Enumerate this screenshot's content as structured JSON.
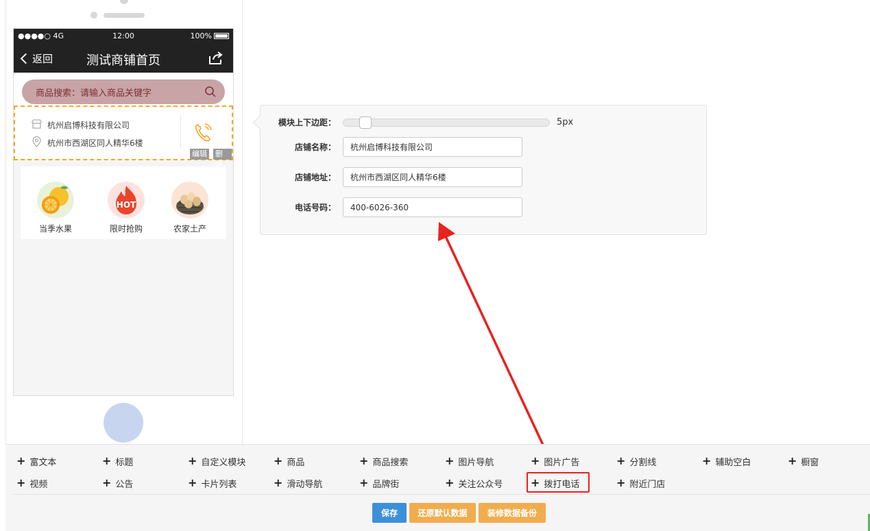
{
  "phone": {
    "status": {
      "signal": "●●●●○ 4G",
      "time": "12:00",
      "battery": "100%"
    },
    "nav": {
      "back_label": "返回",
      "title": "测试商铺首页"
    },
    "search": {
      "placeholder": "商品搜索：请输入商品关键字"
    },
    "shop": {
      "name": "杭州启博科技有限公司",
      "address": "杭州市西湖区同人精华6楼",
      "edit_label": "编辑",
      "delete_label": "删除"
    },
    "categories": [
      {
        "label": "当季水果",
        "icon": "orange-fruit-icon"
      },
      {
        "label": "限时抢购",
        "icon": "hot-sale-icon"
      },
      {
        "label": "农家土产",
        "icon": "eggs-basket-icon"
      }
    ]
  },
  "panel": {
    "margin_label": "模块上下边距：",
    "margin_value": "5px",
    "margin_fraction": 0.08,
    "shop_name_label": "店铺名称：",
    "shop_name_value": "杭州启博科技有限公司",
    "shop_address_label": "店铺地址：",
    "shop_address_value": "杭州市西湖区同人精华6楼",
    "phone_label": "电话号码：",
    "phone_value": "400-6026-360"
  },
  "toolbar": {
    "row1": [
      "富文本",
      "标题",
      "自定义模块",
      "商品",
      "商品搜索",
      "图片导航",
      "图片广告",
      "分割线",
      "辅助空白",
      "橱窗"
    ],
    "row2": [
      "视频",
      "公告",
      "卡片列表",
      "滑动导航",
      "品牌街",
      "关注公众号",
      "拨打电话",
      "附近门店"
    ],
    "save_label": "保存",
    "restore_label": "还原默认数据",
    "backup_label": "装修数据备份"
  },
  "colors": {
    "accent": "#3d8fd8",
    "warning": "#f0ad4e",
    "highlight": "#e8221e",
    "dashed_border": "#f5a623"
  }
}
